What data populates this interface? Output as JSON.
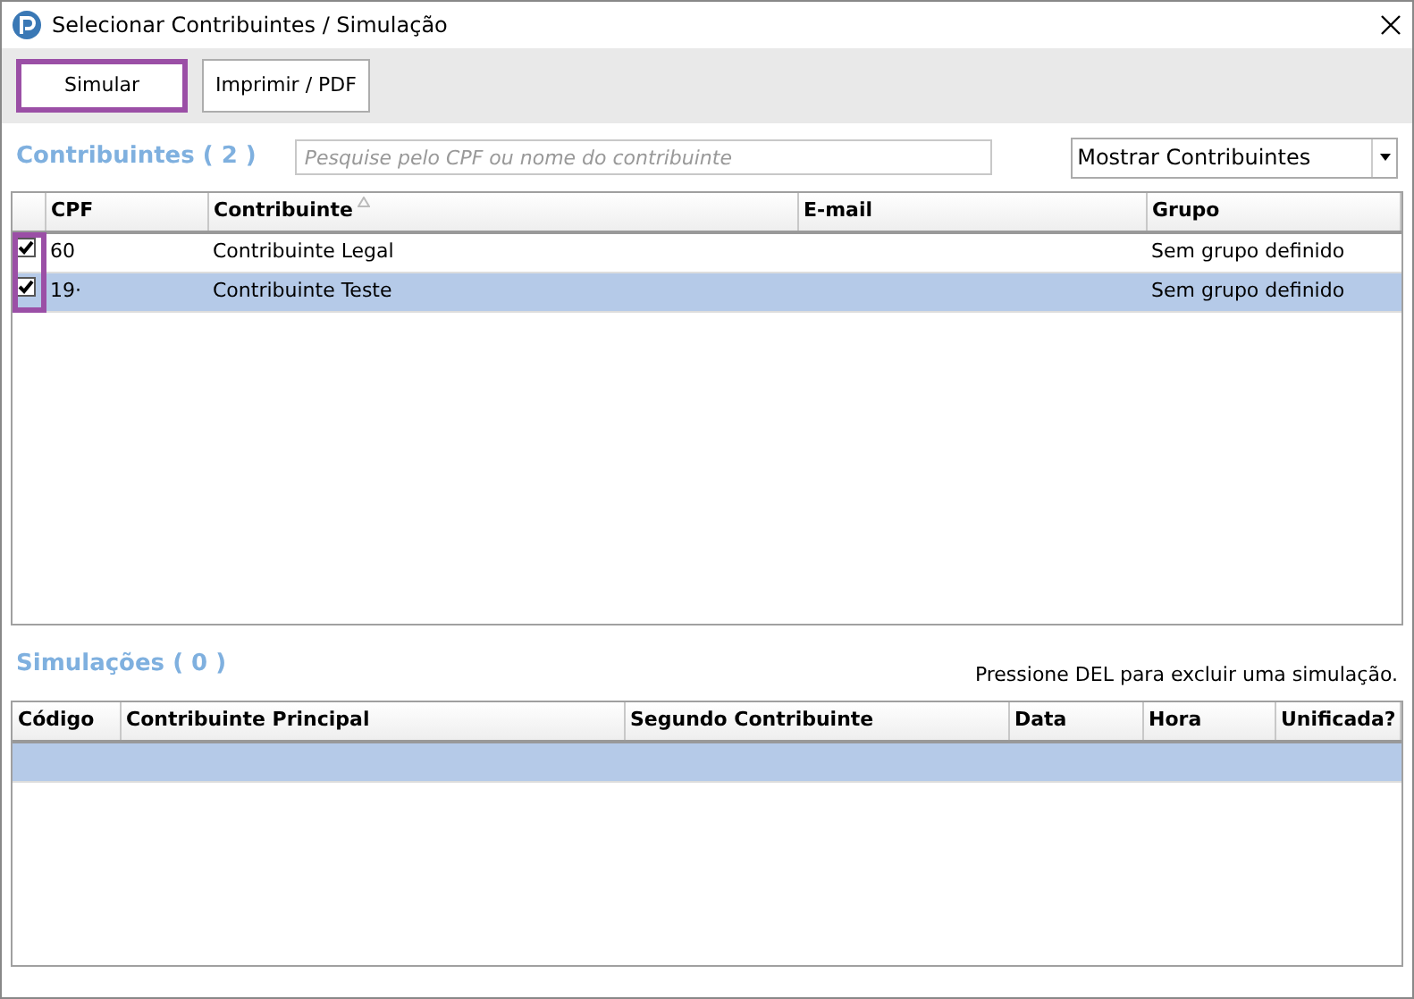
{
  "window": {
    "title": "Selecionar Contribuintes / Simulação"
  },
  "toolbar": {
    "buttons": [
      {
        "label": "Simular",
        "highlighted": true
      },
      {
        "label": "Imprimir / PDF",
        "highlighted": false
      }
    ]
  },
  "contribuintes": {
    "heading": "Contribuintes ( 2 )",
    "search": {
      "placeholder": "Pesquise pelo CPF ou nome do contribuinte"
    },
    "filter": {
      "value": "Mostrar Contribuintes"
    },
    "checkbox_column_highlighted": true,
    "columns": [
      "CPF",
      "Contribuinte",
      "E-mail",
      "Grupo"
    ],
    "rows": [
      {
        "checked": true,
        "selected": false,
        "cells": [
          "60",
          "Contribuinte Legal",
          "",
          "Sem grupo definido"
        ]
      },
      {
        "checked": true,
        "selected": true,
        "cells": [
          "19·",
          "Contribuinte Teste",
          "",
          "Sem grupo definido"
        ]
      }
    ]
  },
  "simulacoes": {
    "heading": "Simulações ( 0 )",
    "hint": "Pressione DEL para excluir uma simulação.",
    "columns": [
      "Código",
      "Contribuinte Principal",
      "Segundo Contribuinte",
      "Data",
      "Hora",
      "Unificada?"
    ],
    "rows": [
      {
        "selected": true
      }
    ]
  }
}
